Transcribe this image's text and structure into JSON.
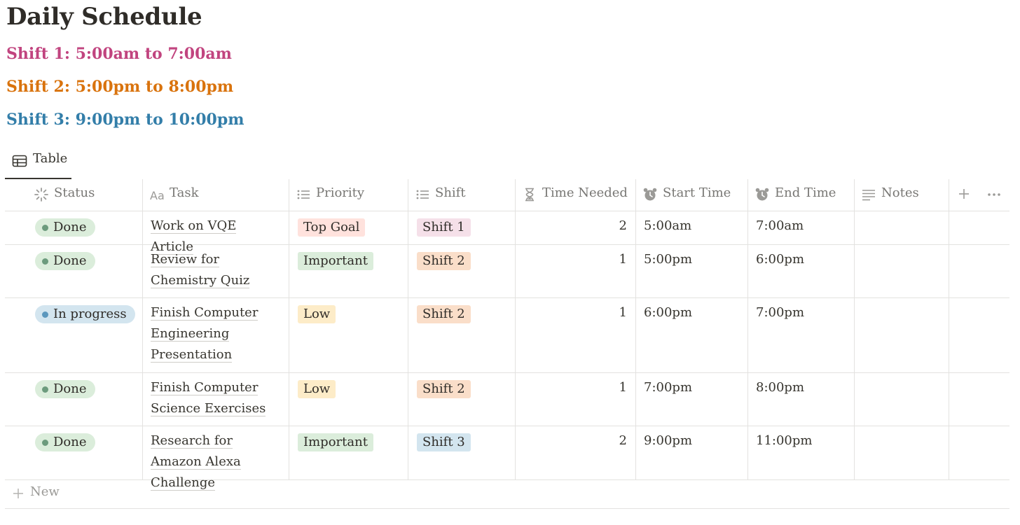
{
  "page": {
    "title": "Daily Schedule",
    "shifts": [
      {
        "text": "Shift 1: 5:00am to 7:00am",
        "color": "#c1447f"
      },
      {
        "text": "Shift 2:  5:00pm to 8:00pm",
        "color": "#d9730d"
      },
      {
        "text": "Shift 3: 9:00pm to 10:00pm",
        "color": "#337ea9"
      }
    ]
  },
  "view": {
    "tab_label": "Table",
    "tab_icon": "table-icon"
  },
  "columns": [
    {
      "label": "Status",
      "icon": "status-loader-icon"
    },
    {
      "label": "Task",
      "icon": "text-aa-icon"
    },
    {
      "label": "Priority",
      "icon": "list-icon"
    },
    {
      "label": "Shift",
      "icon": "list-icon"
    },
    {
      "label": "Time Needed",
      "icon": "hourglass-icon"
    },
    {
      "label": "Start Time",
      "icon": "alarm-clock-icon"
    },
    {
      "label": "End Time",
      "icon": "alarm-clock-icon"
    },
    {
      "label": "Notes",
      "icon": "lines-icon"
    }
  ],
  "add_column_icon": "plus-icon",
  "more_icon": "ellipsis-icon",
  "rows": [
    {
      "status": "Done",
      "task": "Work on VQE Article",
      "priority": "Top Goal",
      "shift": "Shift 1",
      "time_needed": "2",
      "start": "5:00am",
      "end": "7:00am",
      "notes": ""
    },
    {
      "status": "Done",
      "task": "Review for Chemistry Quiz",
      "priority": "Important",
      "shift": "Shift 2",
      "time_needed": "1",
      "start": "5:00pm",
      "end": "6:00pm",
      "notes": ""
    },
    {
      "status": "In progress",
      "task": "Finish Computer Engineering Presentation",
      "priority": "Low",
      "shift": "Shift 2",
      "time_needed": "1",
      "start": "6:00pm",
      "end": "7:00pm",
      "notes": ""
    },
    {
      "status": "Done",
      "task": "Finish Computer Science Exercises",
      "priority": "Low",
      "shift": "Shift 2",
      "time_needed": "1",
      "start": "7:00pm",
      "end": "8:00pm",
      "notes": ""
    },
    {
      "status": "Done",
      "task": "Research for Amazon Alexa Challenge",
      "priority": "Important",
      "shift": "Shift 3",
      "time_needed": "2",
      "start": "9:00pm",
      "end": "11:00pm",
      "notes": ""
    }
  ],
  "new_row_label": "New",
  "colors": {
    "status_done_bg": "#dbeddb",
    "status_done_dot": "#6c9b7d",
    "status_progress_bg": "#d3e5ef",
    "status_progress_dot": "#5b97bd",
    "priority_top_goal": "#ffe2dd",
    "priority_important": "#dbeddb",
    "priority_low": "#fdecc8",
    "shift_1": "#f5e0e9",
    "shift_2": "#fadec9",
    "shift_3": "#d3e5ef"
  }
}
